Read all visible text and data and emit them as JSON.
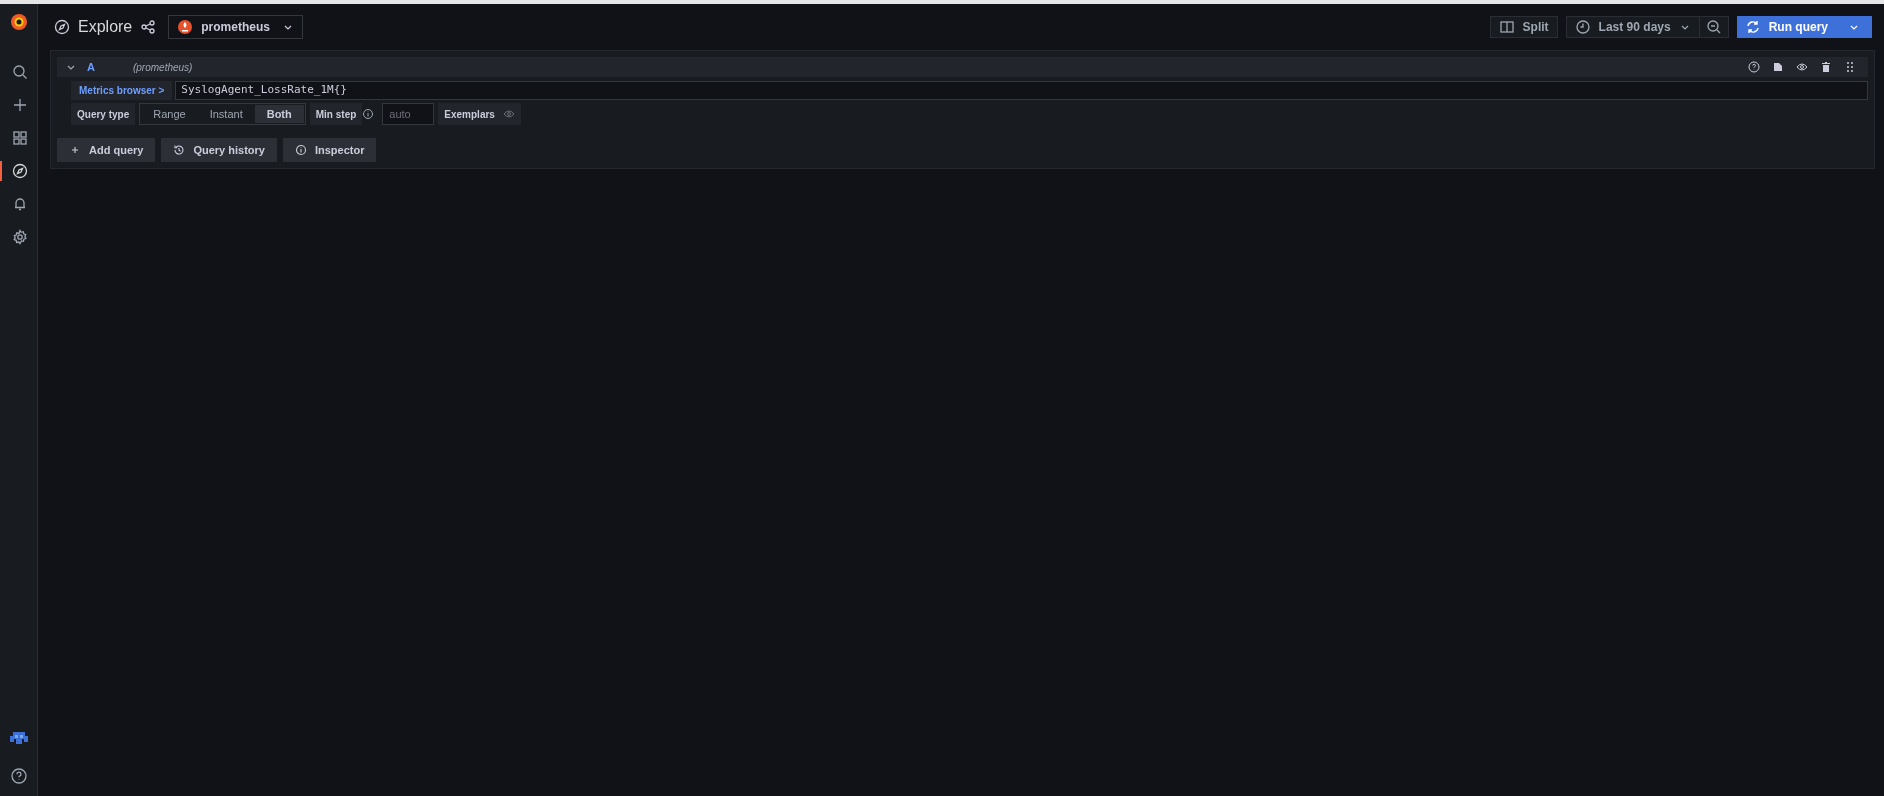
{
  "sidebar": {
    "items": [
      {
        "kind": "search",
        "selected": false
      },
      {
        "kind": "plus",
        "selected": false
      },
      {
        "kind": "grid",
        "selected": false
      },
      {
        "kind": "compass",
        "selected": true
      },
      {
        "kind": "bell",
        "selected": false
      },
      {
        "kind": "gear",
        "selected": false
      }
    ]
  },
  "toolbar": {
    "title": "Explore",
    "datasource": "prometheus",
    "split": "Split",
    "time_range": "Last 90 days",
    "run": "Run query"
  },
  "query": {
    "ref": "A",
    "datasource": "(prometheus)",
    "metrics_browser": "Metrics browser >",
    "expression": "SyslogAgent_LossRate_1M{}",
    "query_type_label": "Query type",
    "query_types": [
      {
        "label": "Range",
        "selected": false
      },
      {
        "label": "Instant",
        "selected": false
      },
      {
        "label": "Both",
        "selected": true
      }
    ],
    "min_step_label": "Min step",
    "min_step_placeholder": "auto",
    "exemplars": "Exemplars"
  },
  "actions": [
    "Add query",
    "Query history",
    "Inspector"
  ]
}
